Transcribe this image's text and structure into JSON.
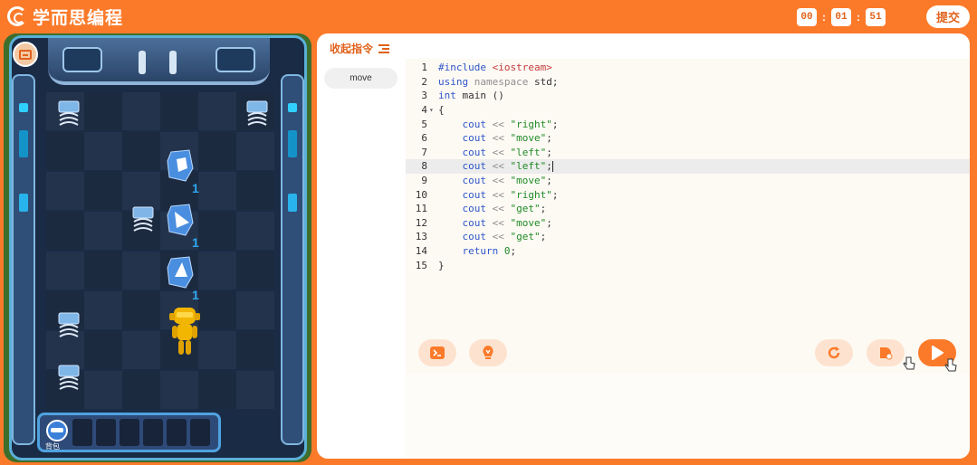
{
  "app": {
    "title": "学而思编程",
    "brand_color": "#fb7a2a",
    "accent_text_color": "#e0621c"
  },
  "timer": {
    "hours": "00",
    "minutes": "01",
    "seconds": "51"
  },
  "header": {
    "submit_label": "提交"
  },
  "sidebar": {
    "collapse_label": "收起指令",
    "commands": [
      "move"
    ]
  },
  "game": {
    "backpack_label": "背包",
    "gem_counts": [
      "1",
      "1",
      "1"
    ]
  },
  "editor": {
    "active_line": 8,
    "lines": [
      {
        "num": "1",
        "fold": "",
        "tokens": [
          {
            "t": "#include ",
            "c": "kw"
          },
          {
            "t": "<iostream>",
            "c": "inc"
          }
        ]
      },
      {
        "num": "2",
        "fold": "",
        "tokens": [
          {
            "t": "using ",
            "c": "kw"
          },
          {
            "t": "namespace",
            "c": "op"
          },
          {
            "t": " std;",
            "c": ""
          }
        ]
      },
      {
        "num": "3",
        "fold": "",
        "tokens": [
          {
            "t": "int",
            "c": "kw"
          },
          {
            "t": " main ()",
            "c": ""
          }
        ]
      },
      {
        "num": "4",
        "fold": "▾",
        "tokens": [
          {
            "t": "{",
            "c": ""
          }
        ]
      },
      {
        "num": "5",
        "fold": "",
        "tokens": [
          {
            "t": "    cout ",
            "c": "kw"
          },
          {
            "t": "<< ",
            "c": "op"
          },
          {
            "t": "\"right\"",
            "c": "str"
          },
          {
            "t": ";",
            "c": ""
          }
        ]
      },
      {
        "num": "6",
        "fold": "",
        "tokens": [
          {
            "t": "    cout ",
            "c": "kw"
          },
          {
            "t": "<< ",
            "c": "op"
          },
          {
            "t": "\"move\"",
            "c": "str"
          },
          {
            "t": ";",
            "c": ""
          }
        ]
      },
      {
        "num": "7",
        "fold": "",
        "tokens": [
          {
            "t": "    cout ",
            "c": "kw"
          },
          {
            "t": "<< ",
            "c": "op"
          },
          {
            "t": "\"left\"",
            "c": "str"
          },
          {
            "t": ";",
            "c": ""
          }
        ]
      },
      {
        "num": "8",
        "fold": "",
        "tokens": [
          {
            "t": "    cout ",
            "c": "kw"
          },
          {
            "t": "<< ",
            "c": "op"
          },
          {
            "t": "\"left\"",
            "c": "str"
          },
          {
            "t": ";",
            "c": ""
          }
        ]
      },
      {
        "num": "9",
        "fold": "",
        "tokens": [
          {
            "t": "    cout ",
            "c": "kw"
          },
          {
            "t": "<< ",
            "c": "op"
          },
          {
            "t": "\"move\"",
            "c": "str"
          },
          {
            "t": ";",
            "c": ""
          }
        ]
      },
      {
        "num": "10",
        "fold": "",
        "tokens": [
          {
            "t": "    cout ",
            "c": "kw"
          },
          {
            "t": "<< ",
            "c": "op"
          },
          {
            "t": "\"right\"",
            "c": "str"
          },
          {
            "t": ";",
            "c": ""
          }
        ]
      },
      {
        "num": "11",
        "fold": "",
        "tokens": [
          {
            "t": "    cout ",
            "c": "kw"
          },
          {
            "t": "<< ",
            "c": "op"
          },
          {
            "t": "\"get\"",
            "c": "str"
          },
          {
            "t": ";",
            "c": ""
          }
        ]
      },
      {
        "num": "12",
        "fold": "",
        "tokens": [
          {
            "t": "    cout ",
            "c": "kw"
          },
          {
            "t": "<< ",
            "c": "op"
          },
          {
            "t": "\"move\"",
            "c": "str"
          },
          {
            "t": ";",
            "c": ""
          }
        ]
      },
      {
        "num": "13",
        "fold": "",
        "tokens": [
          {
            "t": "    cout ",
            "c": "kw"
          },
          {
            "t": "<< ",
            "c": "op"
          },
          {
            "t": "\"get\"",
            "c": "str"
          },
          {
            "t": ";",
            "c": ""
          }
        ]
      },
      {
        "num": "14",
        "fold": "",
        "tokens": [
          {
            "t": "    return ",
            "c": "kw"
          },
          {
            "t": "0",
            "c": "str"
          },
          {
            "t": ";",
            "c": ""
          }
        ]
      },
      {
        "num": "15",
        "fold": "",
        "tokens": [
          {
            "t": "}",
            "c": ""
          }
        ]
      }
    ]
  },
  "toolbar": {
    "buttons": [
      {
        "name": "terminal-button",
        "icon": "terminal-icon"
      },
      {
        "name": "hint-button",
        "icon": "lightbulb-icon"
      },
      {
        "name": "reset-button",
        "icon": "refresh-icon"
      },
      {
        "name": "step-run-button",
        "icon": "step-icon"
      },
      {
        "name": "run-button",
        "icon": "play-icon"
      }
    ]
  }
}
